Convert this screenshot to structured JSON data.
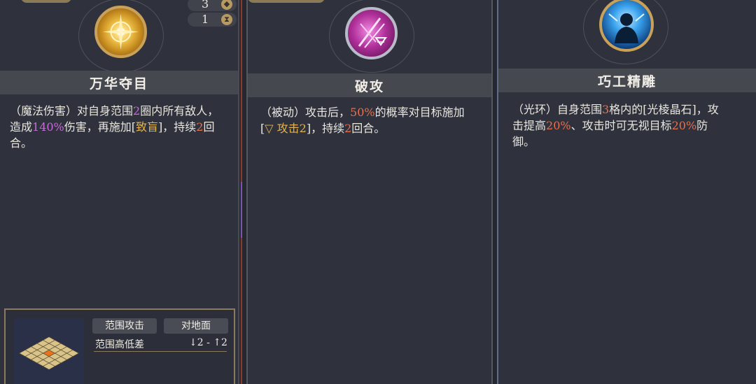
{
  "counters": [
    {
      "value": "3",
      "icon": "diamond-icon"
    },
    {
      "value": "1",
      "icon": "hourglass-icon"
    }
  ],
  "cards": [
    {
      "title": "万华夺目",
      "desc": [
        {
          "t": "（魔法伤害）对自身范围"
        },
        {
          "t": "2",
          "c": "hl"
        },
        {
          "t": "圈内所有敌人，"
        },
        {
          "br": true
        },
        {
          "t": "造成"
        },
        {
          "t": "140%",
          "c": "hl"
        },
        {
          "t": "伤害，再施加["
        },
        {
          "t": "致盲",
          "c": "hl-y"
        },
        {
          "t": "]，持续"
        },
        {
          "t": "2",
          "c": "hl-o"
        },
        {
          "t": "回"
        },
        {
          "br": true
        },
        {
          "t": "合。"
        }
      ],
      "icon": "sun-burst-icon",
      "colors": {
        "icon_bg": "#d9a63a",
        "icon_ring": "#c9a158"
      }
    },
    {
      "title": "破攻",
      "desc": [
        {
          "t": "（被动）攻击后，"
        },
        {
          "t": "50%",
          "c": "hl-o"
        },
        {
          "t": "的概率对目标施加"
        },
        {
          "br": true
        },
        {
          "t": "["
        },
        {
          "t": "▽ 攻击2",
          "c": "hl-y"
        },
        {
          "t": "]，持续"
        },
        {
          "t": "2",
          "c": "hl-o"
        },
        {
          "t": "回合。"
        }
      ],
      "icon": "slash-debuff-icon",
      "colors": {
        "icon_bg": "#b0309a",
        "icon_ring": "#b8bcc8"
      }
    },
    {
      "title": "巧工精雕",
      "desc": [
        {
          "t": "（光环）自身范围"
        },
        {
          "t": "3",
          "c": "hl-o"
        },
        {
          "t": "格内的[光棱晶石]，攻"
        },
        {
          "br": true
        },
        {
          "t": "击提高"
        },
        {
          "t": "20%",
          "c": "hl-o"
        },
        {
          "t": "、攻击时可无视目标"
        },
        {
          "t": "20%",
          "c": "hl-o"
        },
        {
          "t": "防"
        },
        {
          "br": true
        },
        {
          "t": "御。"
        }
      ],
      "icon": "aura-figure-icon",
      "colors": {
        "icon_bg": "#1d7fd0",
        "icon_ring": "#c9a158"
      }
    }
  ],
  "range": {
    "chip_attack": "范围攻击",
    "chip_target": "对地面",
    "label": "范围高低差",
    "value": "↓2 - ↑2"
  }
}
